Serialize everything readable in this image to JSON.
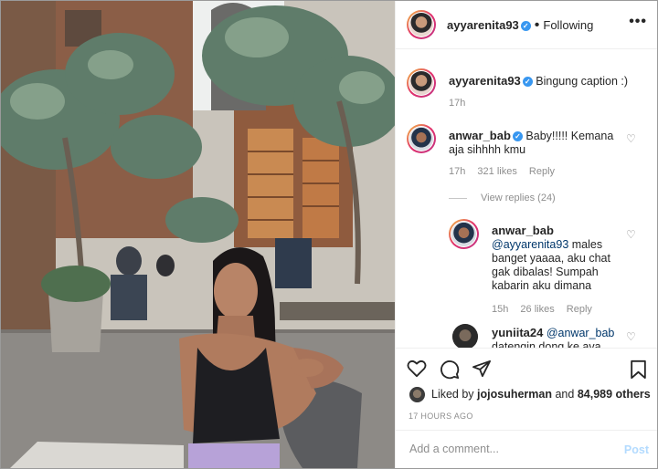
{
  "header": {
    "username": "ayyarenita93",
    "separator": "•",
    "follow_state": "Following",
    "more_icon": "more-horizontal-icon"
  },
  "caption": {
    "username": "ayyarenita93",
    "text": "Bingung caption :)",
    "time": "17h"
  },
  "comments": [
    {
      "username": "anwar_bab",
      "text": "Baby!!!!! Kemana aja sihhhh kmu",
      "time": "17h",
      "likes": "321 likes",
      "reply": "Reply",
      "view_replies": "View replies (24)"
    }
  ],
  "replies": [
    {
      "username": "anwar_bab",
      "mention": "@ayyarenita93",
      "text": " males banget yaaaa, aku chat gak dibalas! Sumpah kabarin aku dimana",
      "time": "15h",
      "likes": "26 likes",
      "reply": "Reply"
    },
    {
      "username": "yuniita24",
      "mention": "@anwar_bab",
      "text": "datengin dong ke ava"
    }
  ],
  "actions": {
    "liked_by_prefix": "Liked by ",
    "liked_by_user": "jojosuherman",
    "liked_by_middle": " and ",
    "liked_by_count": "84,989 others",
    "time_ago": "17 HOURS AGO"
  },
  "add_comment": {
    "placeholder": "Add a comment...",
    "post_label": "Post"
  },
  "colors": {
    "link": "#00376b",
    "verified": "#3897f0",
    "muted": "#8e8e8e",
    "post_disabled": "#b3dbff"
  }
}
